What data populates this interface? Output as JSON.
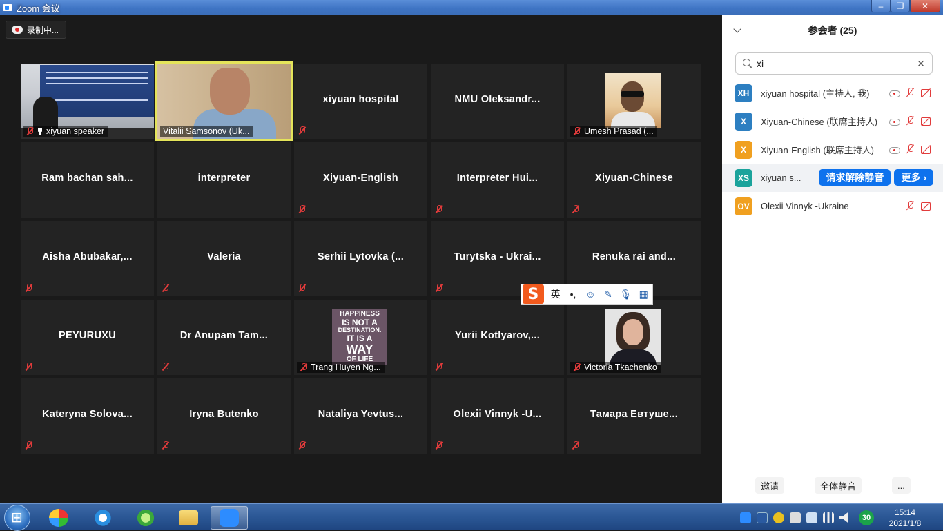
{
  "window": {
    "title": "Zoom 会议"
  },
  "recording": {
    "label": "录制中..."
  },
  "tiles": [
    {
      "name": "xiyuan speaker",
      "video": "slides",
      "pinned": true
    },
    {
      "name": "Vitalii Samsonov (Uk...",
      "video": "room",
      "active": true
    },
    {
      "name": "xiyuan hospital"
    },
    {
      "name": "NMU  Oleksandr..."
    },
    {
      "name": "Umesh Prasad (...",
      "video": "desert"
    },
    {
      "name": "Ram bachan sah..."
    },
    {
      "name": "interpreter"
    },
    {
      "name": "Xiyuan-English"
    },
    {
      "name": "Interpreter  Hui..."
    },
    {
      "name": "Xiyuan-Chinese"
    },
    {
      "name": "Aisha  Abubakar,..."
    },
    {
      "name": "Valeria"
    },
    {
      "name": "Serhii  Lytovka  (..."
    },
    {
      "name": "Turytska - Ukrai..."
    },
    {
      "name": "Renuka rai and..."
    },
    {
      "name": "PEYURUXU"
    },
    {
      "name": "Dr Anupam Tam..."
    },
    {
      "name": "Trang Huyen Ng...",
      "video": "poster"
    },
    {
      "name": "Yurii  Kotlyarov,..."
    },
    {
      "name": "Victoria Tkachenko",
      "video": "woman"
    },
    {
      "name": "Kateryna  Solova..."
    },
    {
      "name": "Iryna Butenko"
    },
    {
      "name": "Nataliya  Yevtus..."
    },
    {
      "name": "Olexii  Vinnyk  -U..."
    },
    {
      "name": "Тамара  Евтуше..."
    }
  ],
  "poster_lines": [
    "HAPPINESS",
    "IS NOT A",
    "DESTINATION.",
    "IT IS A",
    "WAY",
    "OF LIFE"
  ],
  "participants_panel": {
    "title": "参会者 (25)",
    "search_value": "xi",
    "participants": [
      {
        "initials": "XH",
        "name": "xiyuan hospital (主持人, 我)",
        "color": "#2d7fc1",
        "cloud": true,
        "mic_muted": true,
        "cam_muted": true
      },
      {
        "initials": "X",
        "name": "Xiyuan-Chinese (联席主持人)",
        "color": "#2d7fc1",
        "cloud": true,
        "mic_muted": true,
        "cam_muted": true
      },
      {
        "initials": "X",
        "name": "Xiyuan-English (联席主持人)",
        "color": "#f0a020",
        "cloud": true,
        "mic_muted": true,
        "cam_muted": true
      },
      {
        "initials": "XS",
        "name": "xiyuan s...",
        "color": "#1ba39c",
        "actions": [
          "请求解除静音",
          "更多 ›"
        ]
      },
      {
        "initials": "OV",
        "name": "Olexii Vinnyk -Ukraine",
        "color": "#f0a020",
        "mic_muted": true,
        "cam_muted": true
      }
    ],
    "footer": {
      "invite": "邀请",
      "mute_all": "全体静音",
      "more": "..."
    }
  },
  "ime": {
    "lang": "英",
    "punct": "•,",
    "items": [
      "emoji-icon",
      "brush-icon",
      "mic-icon",
      "grid-icon"
    ]
  },
  "taskbar": {
    "time": "15:14",
    "date": "2021/1/8",
    "badge": "30"
  }
}
